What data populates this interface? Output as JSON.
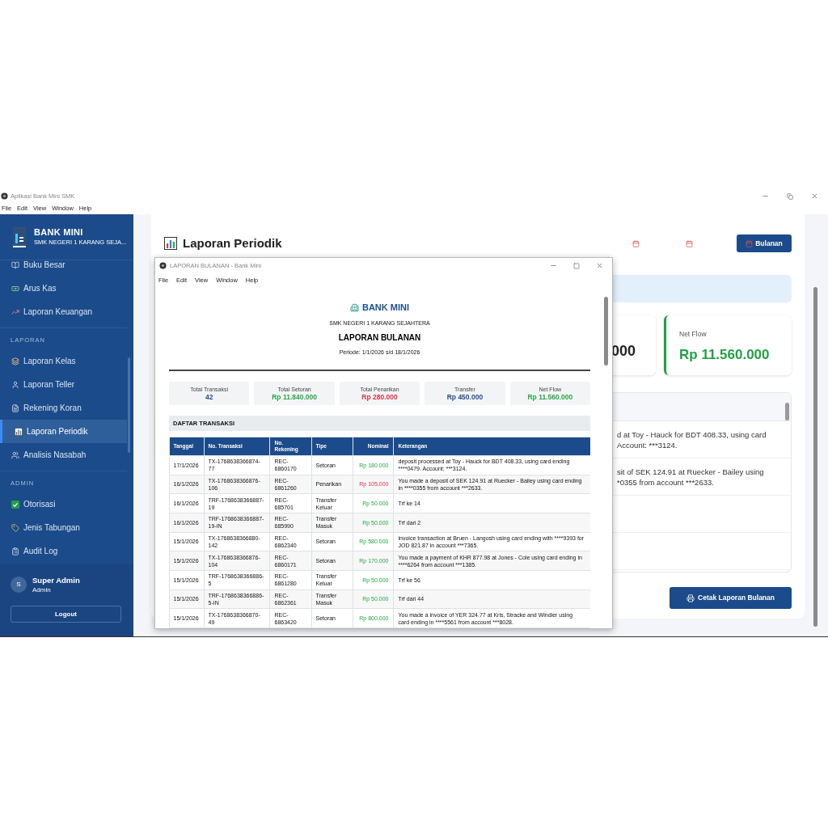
{
  "window": {
    "title": "Aplikasi Bank Mini SMK",
    "menu": [
      "File",
      "Edit",
      "View",
      "Window",
      "Help"
    ]
  },
  "sidebar": {
    "brand": "BANK MINI",
    "subtitle": "SMK NEGERI 1 KARANG SEJA...",
    "sections": [
      {
        "items": [
          {
            "label": "Buku Besar",
            "selected": false
          },
          {
            "label": "Arus Kas",
            "selected": false
          },
          {
            "label": "Laporan Keuangan",
            "selected": false
          }
        ]
      },
      {
        "label": "LAPORAN",
        "items": [
          {
            "label": "Laporan Kelas",
            "selected": false
          },
          {
            "label": "Laporan Teller",
            "selected": false
          },
          {
            "label": "Rekening Koran",
            "selected": false
          },
          {
            "label": "Laporan Periodik",
            "selected": true
          },
          {
            "label": "Analisis Nasabah",
            "selected": false
          }
        ]
      },
      {
        "label": "ADMIN",
        "items": [
          {
            "label": "Otorisasi",
            "selected": false
          },
          {
            "label": "Jenis Tabungan",
            "selected": false
          },
          {
            "label": "Audit Log",
            "selected": false
          }
        ]
      }
    ],
    "user": {
      "initial": "S",
      "name": "Super Admin",
      "role": "Admin"
    },
    "logout": "Logout"
  },
  "main": {
    "title": "Laporan Periodik",
    "period_buttons": [
      {
        "selected": false
      },
      {
        "selected": false
      },
      {
        "label": "Bulanan",
        "selected": true
      }
    ],
    "stat_partial": {
      "value": "000"
    },
    "stat_net": {
      "label": "Net Flow",
      "value": "Rp 11.560.000"
    },
    "table_rows": [
      {
        "lines": [
          "d at Toy - Hauck for BDT 408.33, using card",
          "Account: ***3124."
        ]
      },
      {
        "lines": [
          "sit of SEK 124.91 at Ruecker - Bailey using",
          "*0355 from account ***2633."
        ]
      }
    ],
    "print_button": "Cetak Laporan Bulanan"
  },
  "report_window": {
    "title": "LAPORAN BULANAN - Bank Mini",
    "menu": [
      "File",
      "Edit",
      "View",
      "Window",
      "Help"
    ],
    "brand": "BANK MINI",
    "school": "SMK NEGERI 1 KARANG SEJAHTERA",
    "heading": "LAPORAN BULANAN",
    "period": "Periode: 1/1/2026 s/d 18/1/2026",
    "stats": [
      {
        "label": "Total Transaksi",
        "value": "42",
        "color": "#1f4e8c"
      },
      {
        "label": "Total Setoran",
        "value": "Rp 11.840.000",
        "color": "#28a745"
      },
      {
        "label": "Total Penarikan",
        "value": "Rp 280.000",
        "color": "#dc3545"
      },
      {
        "label": "Transfer",
        "value": "Rp 450.000",
        "color": "#1f4e8c"
      },
      {
        "label": "Net Flow",
        "value": "Rp 11.560.000",
        "color": "#28a745"
      }
    ],
    "section_title": "DAFTAR TRANSAKSI",
    "columns": [
      "Tanggal",
      "No. Transaksi",
      "No. Rekening",
      "Tipe",
      "Nominal",
      "Keterangan"
    ],
    "rows": [
      {
        "date": "17/1/2026",
        "trx": "TX-1768638366874-77",
        "account": "REC-6860170",
        "type": "Setoran",
        "amount": "Rp 180.000",
        "kind": "credit",
        "note": "deposit processed at Toy - Hauck for BDT 408.33, using card ending ****0479. Account: ***3124."
      },
      {
        "date": "16/1/2026",
        "trx": "TX-1768638366876-106",
        "account": "REC-6861260",
        "type": "Penarikan",
        "amount": "Rp 105.000",
        "kind": "debit",
        "note": "You made a deposit of SEK 124.91 at Ruecker - Bailey using card ending in ****0355 from account ***2633."
      },
      {
        "date": "16/1/2026",
        "trx": "TRF-1768638366887-19",
        "account": "REC-685701",
        "type": "Transfer Keluar",
        "amount": "Rp 50.000",
        "kind": "credit",
        "note": "Trf ke 14"
      },
      {
        "date": "16/1/2026",
        "trx": "TRF-1768638366887-19-IN",
        "account": "REC-685990",
        "type": "Transfer Masuk",
        "amount": "Rp 50.000",
        "kind": "credit",
        "note": "Trf dari 2"
      },
      {
        "date": "15/1/2026",
        "trx": "TX-1768638366880-142",
        "account": "REC-6862340",
        "type": "Setoran",
        "amount": "Rp 580.000",
        "kind": "credit",
        "note": "invoice transaction at Bruen - Langosh using card ending with ****9393 for JOD 821.87 in account ***7365."
      },
      {
        "date": "15/1/2026",
        "trx": "TX-1768638366876-104",
        "account": "REC-6860171",
        "type": "Setoran",
        "amount": "Rp 170.000",
        "kind": "credit",
        "note": "You made a payment of KHR 877.98 at Jones - Cole using card ending in ****6264 from account ***1385."
      },
      {
        "date": "15/1/2026",
        "trx": "TRF-1768638366886-5",
        "account": "REC-6861280",
        "type": "Transfer Keluar",
        "amount": "Rp 50.000",
        "kind": "credit",
        "note": "Trf ke 56"
      },
      {
        "date": "15/1/2026",
        "trx": "TRF-1768638366886-5-IN",
        "account": "REC-6862361",
        "type": "Transfer Masuk",
        "amount": "Rp 50.000",
        "kind": "credit",
        "note": "Trf dari 44"
      },
      {
        "date": "15/1/2026",
        "trx": "TX-1768638366870-49",
        "account": "REC-6863420",
        "type": "Setoran",
        "amount": "Rp 800.000",
        "kind": "credit",
        "note": "You made a invoice of YER 324.77 at Kris, Stracke and Windler using card ending in ****5561 from account ***8028."
      }
    ]
  }
}
